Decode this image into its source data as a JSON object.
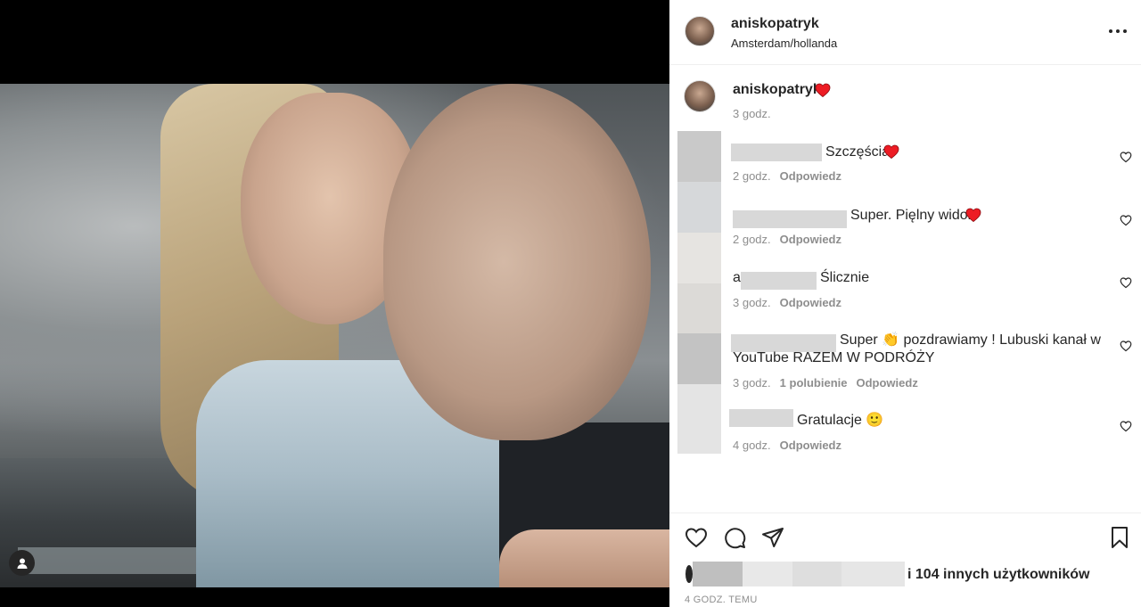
{
  "post": {
    "username": "aniskopatryk",
    "location": "Amsterdam/hollanda"
  },
  "caption": {
    "username": "aniskopatryk",
    "heart": "❤",
    "time": "3 godz."
  },
  "comments": [
    {
      "text": "Szczęścia",
      "emoji": "❤",
      "time": "2 godz.",
      "likes": "",
      "reply": "Odpowiedz"
    },
    {
      "text": "Super. Pięlny widok",
      "emoji": "❤",
      "time": "2 godz.",
      "likes": "",
      "reply": "Odpowiedz"
    },
    {
      "text": "Ślicznie",
      "emoji": "",
      "prefix": "a",
      "time": "3 godz.",
      "likes": "",
      "reply": "Odpowiedz"
    },
    {
      "text_line1": "Super 👏 pozdrawiamy ! Lubuski kanał w",
      "text_line2": "YouTube RAZEM W PODRÓŻY",
      "time": "3 godz.",
      "likes": "1 polubienie",
      "reply": "Odpowiedz"
    },
    {
      "text": "Gratulacje 🙂",
      "time": "4 godz.",
      "likes": "",
      "reply": "Odpowiedz"
    }
  ],
  "likes": {
    "text": "i 104 innych użytkowników"
  },
  "timestamp": "4 GODZ. TEMU",
  "icons": {
    "more": "more-options-icon",
    "like": "heart-icon",
    "comment": "comment-icon",
    "share": "share-icon",
    "save": "bookmark-icon",
    "user_tag": "user-tag-icon"
  },
  "colors": {
    "heart_red": "#ed1c24",
    "text": "#262626",
    "secondary": "#8e8e8e"
  }
}
